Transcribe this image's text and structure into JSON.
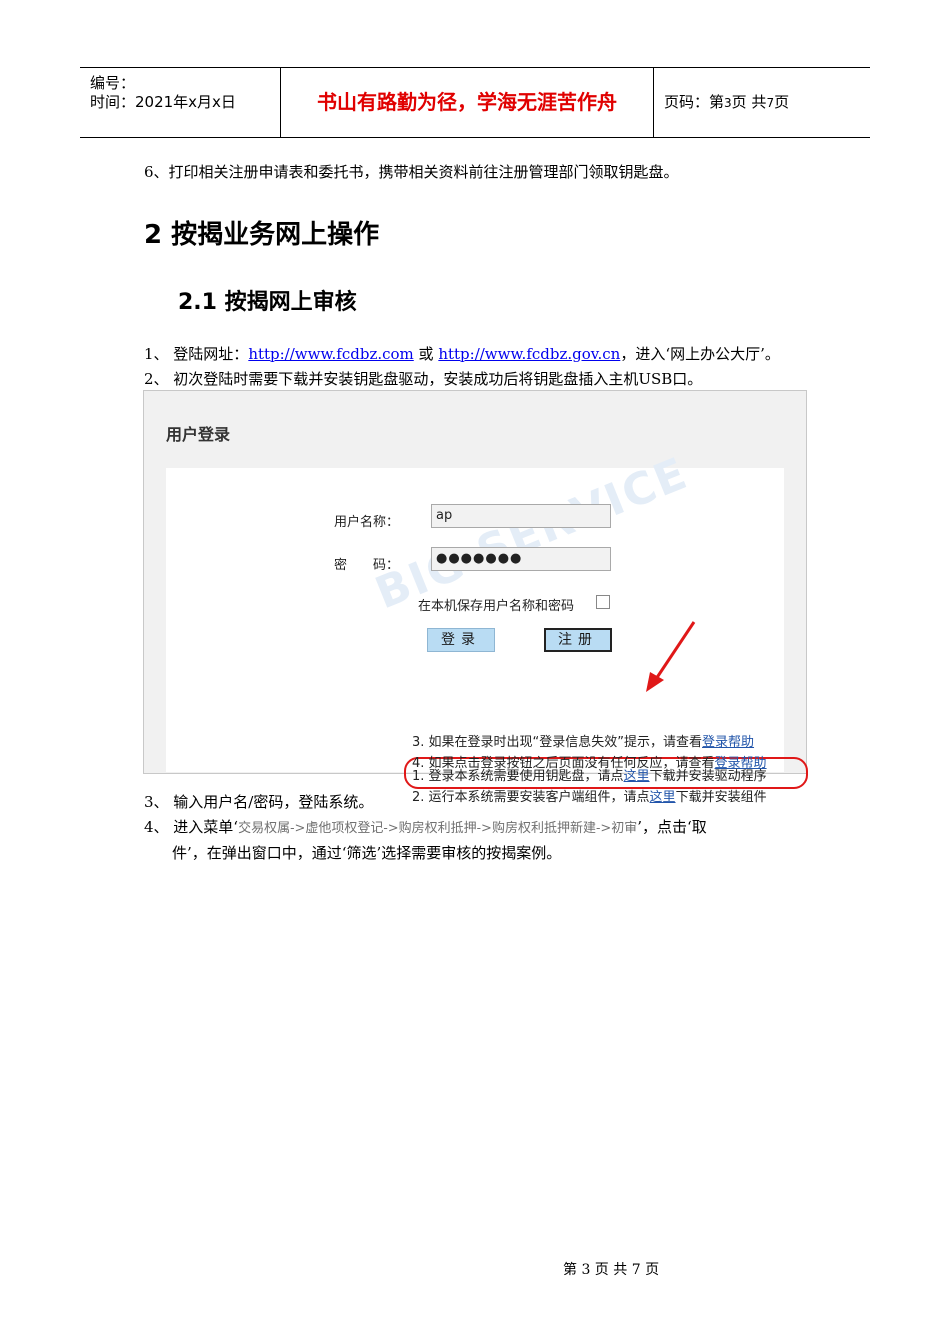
{
  "header": {
    "number_label": "编号：",
    "date_label": "时间：2021年x月x日",
    "motto": "书山有路勤为径，学海无涯苦作舟",
    "page_prefix": "页码：第",
    "page_current": "3",
    "page_mid": "页  共",
    "page_total": "7",
    "page_suffix": "页"
  },
  "step6": "6、打印相关注册申请表和委托书，携带相关资料前往注册管理部门领取钥匙盘。",
  "heading1": "2   按揭业务网上操作",
  "heading2": "2.1  按揭网上审核",
  "item1": {
    "prefix": "1、  登陆网址：",
    "link1": "http://www.fcdbz.com",
    "or": " 或 ",
    "link2": "http://www.fcdbz.gov.cn",
    "suffix": "，进入‘网上办公大厅’。"
  },
  "item2": "2、  初次登陆时需要下载并安装钥匙盘驱动，安装成功后将钥匙盘插入主机USB口。",
  "login": {
    "title": "用户登录",
    "watermark": "BIG SERVICE",
    "username_label": "用户名称：",
    "username_value": "ap",
    "password_label": "密　　码：",
    "password_value": "●●●●●●●",
    "remember_label": "在本机保存用户名称和密码",
    "login_button": "登录",
    "register_button": "注册",
    "notes": [
      {
        "pre": "1. 登录本系统需要使用钥匙盘，请点",
        "link": "这里",
        "post": "下载并安装驱动程序"
      },
      {
        "pre": "2. 运行本系统需要安装客户端组件，请点",
        "link": "这里",
        "post": "下载并安装组件"
      },
      {
        "pre": "3. 如果在登录时出现“登录信息失效”提示，请查看",
        "link": "登录帮助",
        "post": ""
      },
      {
        "pre": "4. 如果点击登录按钮之后页面没有任何反应，请查看",
        "link": "登录帮助",
        "post": ""
      }
    ]
  },
  "item3": "3、  输入用户名/密码，登陆系统。",
  "item4": {
    "prefix": "4、  进入菜单‘",
    "menu_path": "交易权属->虚他项权登记->购房权利抵押->购房权利抵押新建->初审",
    "suffix": "’，点击‘取",
    "line2": "件’，在弹出窗口中，通过‘筛选’选择需要审核的按揭案例。"
  },
  "footer": "第 3 页 共 7 页"
}
